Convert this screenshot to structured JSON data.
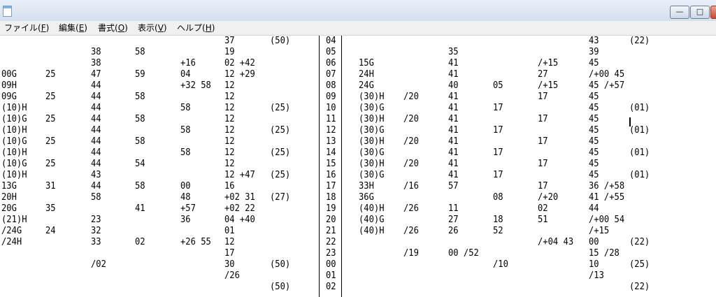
{
  "window": {
    "buttons": {
      "minimize": "—",
      "maximize": "□",
      "close": "✕"
    }
  },
  "menu": [
    {
      "label": "ファイル",
      "accel": "F"
    },
    {
      "label": "編集",
      "accel": "E"
    },
    {
      "label": "書式",
      "accel": "O"
    },
    {
      "label": "表示",
      "accel": "V"
    },
    {
      "label": "ヘルプ",
      "accel": "H"
    }
  ],
  "doc": {
    "left": {
      "c1": [
        "",
        "",
        "",
        "00G",
        "09H",
        "09G",
        "(10)H",
        "(10)G",
        "(10)H",
        "(10)G",
        "(10)H",
        "(10)G",
        "(10)H",
        "13G",
        "20H",
        "20G",
        "(21)H",
        "/24G",
        "/24H",
        "",
        "",
        "",
        ""
      ],
      "c2": [
        "",
        "",
        "",
        "25",
        "",
        "25",
        "",
        "25",
        "",
        "25",
        "",
        "25",
        "",
        "31",
        "",
        "35",
        "",
        "24",
        "",
        "",
        "",
        "",
        ""
      ],
      "c3": [
        "",
        "38",
        "38",
        "47",
        "44",
        "44",
        "44",
        "44",
        "44",
        "44",
        "44",
        "44",
        "43",
        "44",
        "58",
        "",
        "23",
        "32",
        "33",
        "",
        "/02",
        "",
        ""
      ],
      "c4": [
        "",
        "58",
        "",
        "59",
        "",
        "58",
        "",
        "58",
        "",
        "58",
        "",
        "54",
        "",
        "58",
        "",
        "41",
        "",
        "",
        "02",
        "",
        "",
        "",
        ""
      ],
      "c5": [
        "",
        "",
        "+16",
        "04",
        "+32 58",
        "",
        "58",
        "",
        "58",
        "",
        "58",
        "",
        "",
        "00",
        "48",
        "+57",
        "36",
        "",
        "+26 55",
        "",
        "",
        "",
        ""
      ],
      "c6": [
        "37",
        "19",
        "02 +42",
        "12 +29",
        "12",
        "12",
        "12",
        "12",
        "12",
        "12",
        "12",
        "12",
        "12 +47",
        "16",
        "+02 31",
        "+02 22",
        "04 +40",
        "01",
        "12",
        "17",
        "30",
        "/26",
        ""
      ],
      "c7": [
        "(50)",
        "",
        "",
        "",
        "",
        "",
        "(25)",
        "",
        "(25)",
        "",
        "(25)",
        "",
        "(25)",
        "",
        "(27)",
        "",
        "",
        "",
        "",
        "",
        "(50)",
        "",
        "(50)"
      ]
    },
    "right": {
      "c0": [
        "04",
        "05",
        "06",
        "07",
        "08",
        "09",
        "10",
        "11",
        "12",
        "13",
        "14",
        "15",
        "16",
        "17",
        "18",
        "19",
        "20",
        "21",
        "22",
        "23",
        "00",
        "01",
        "02"
      ],
      "c1": [
        "",
        "",
        "15G",
        "24H",
        "24G",
        "(30)H",
        "(30)G",
        "(30)H",
        "(30)G",
        "(30)H",
        "(30)G",
        "(30)H",
        "(30)G",
        "33H",
        "36G",
        "(40)H",
        "(40)G",
        "(40)H",
        "",
        "",
        "",
        "",
        ""
      ],
      "c2": [
        "",
        "",
        "",
        "",
        "",
        "/20",
        "",
        "/20",
        "",
        "/20",
        "",
        "/20",
        "",
        "/16",
        "",
        "/26",
        "",
        "/26",
        "",
        "/19",
        "",
        "",
        ""
      ],
      "c3": [
        "",
        "35",
        "41",
        "41",
        "40",
        "41",
        "41",
        "41",
        "41",
        "41",
        "41",
        "41",
        "41",
        "57",
        "",
        "11",
        "27",
        "26",
        "",
        "00 /52",
        "",
        "",
        ""
      ],
      "c4": [
        "",
        "",
        "",
        "",
        "05",
        "",
        "17",
        "",
        "17",
        "",
        "17",
        "",
        "17",
        "",
        "08",
        "",
        "18",
        "52",
        "",
        "",
        "/10",
        "",
        ""
      ],
      "c5": [
        "",
        "",
        "/+15",
        "27",
        "/+15",
        "17",
        "",
        "17",
        "",
        "17",
        "",
        "17",
        "",
        "17",
        "/+20",
        "02",
        "51",
        "",
        "/+04 43",
        "",
        "",
        "",
        ""
      ],
      "c6": [
        "43",
        "39",
        "45",
        "/+00 45",
        "45 /+57",
        "45",
        "45",
        "45",
        "45",
        "45",
        "45",
        "45",
        "45",
        "36 /+58",
        "41 /+55",
        "44",
        "/+00 54",
        "/+15",
        "00",
        "15 /28",
        "10",
        "/13",
        ""
      ],
      "c7": [
        "(22)",
        "",
        "",
        "",
        "",
        "",
        "(01)",
        "",
        "(01)",
        "",
        "(01)",
        "",
        "(01)",
        "",
        "",
        "",
        "",
        "",
        "(22)",
        "",
        "(25)",
        "",
        "(22)"
      ]
    }
  }
}
